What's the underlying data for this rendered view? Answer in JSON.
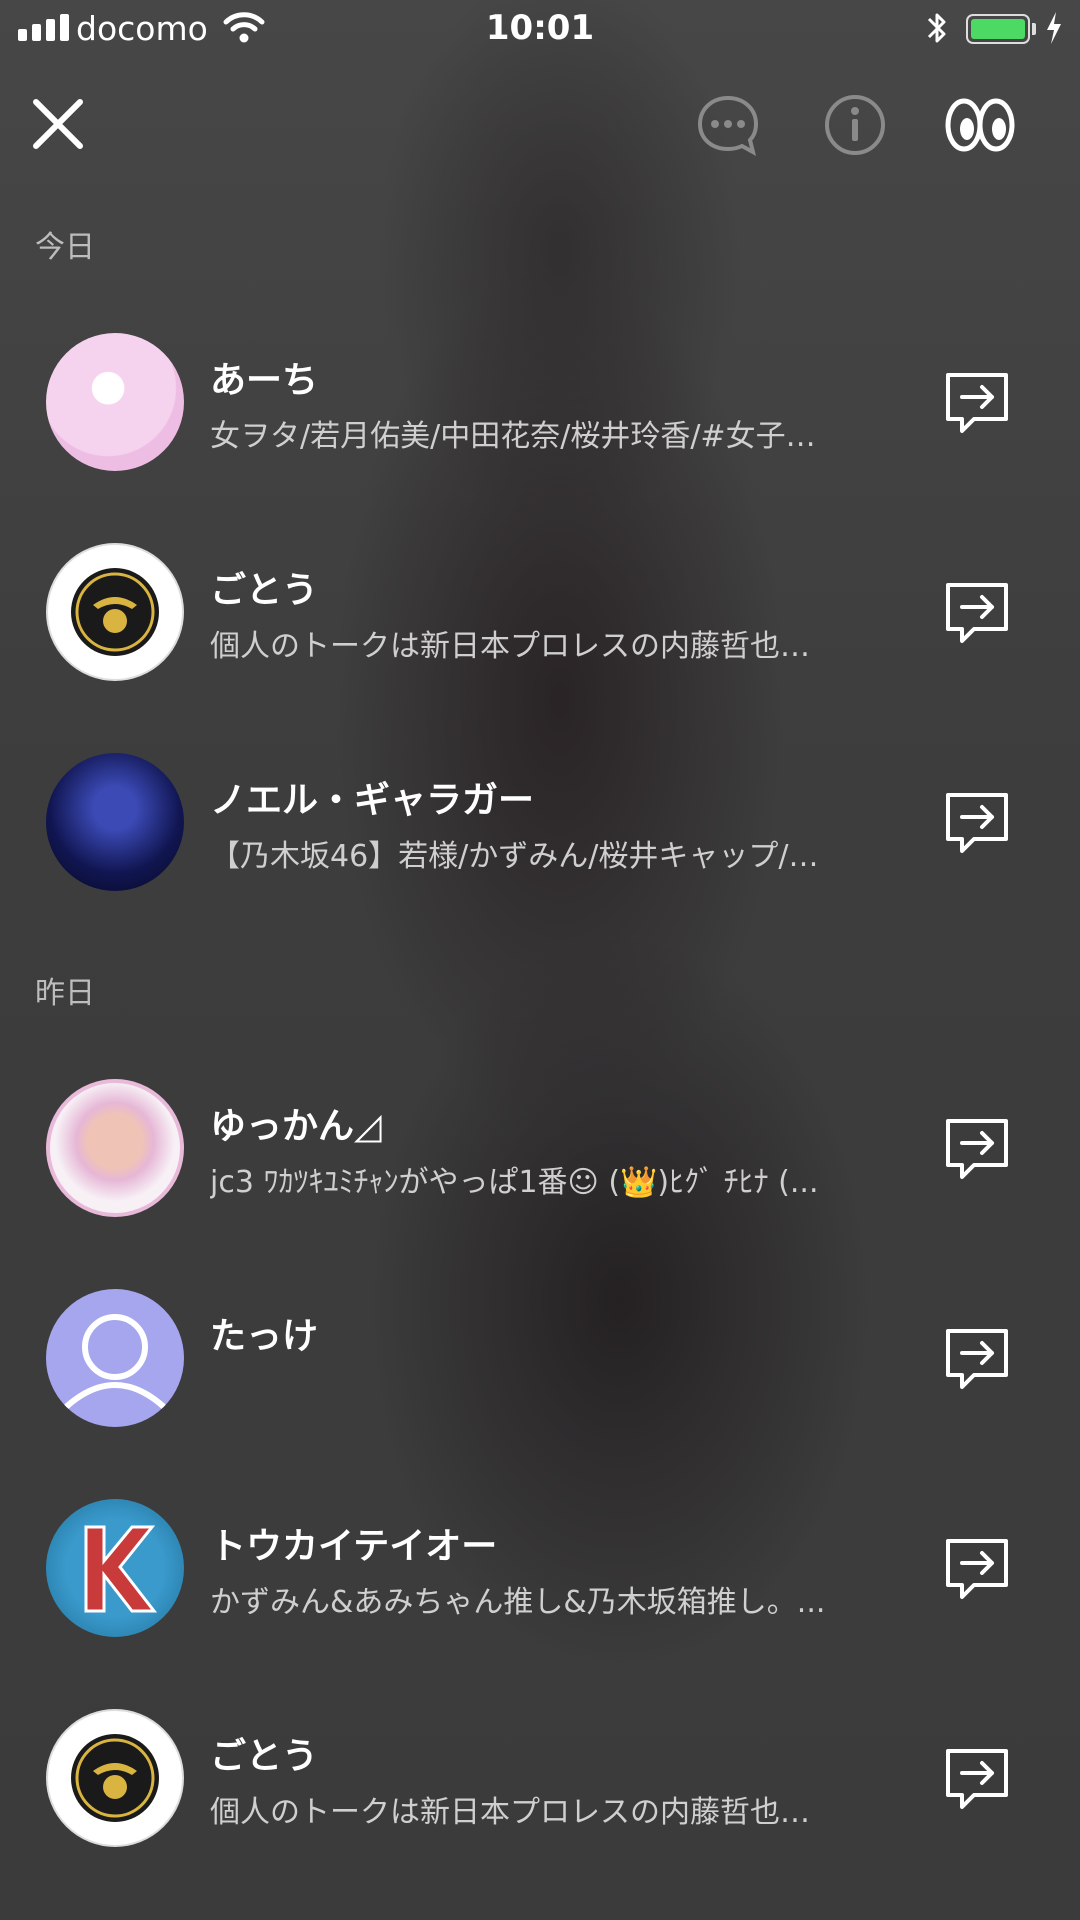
{
  "status_bar": {
    "carrier": "docomo",
    "time": "10:01"
  },
  "header": {
    "icons": [
      "close-icon",
      "chat-bubble-icon",
      "info-icon",
      "eyes-icon"
    ]
  },
  "sections": {
    "today": {
      "label": "今日",
      "items": [
        {
          "name": "あーち",
          "desc": "女ヲタ/若月佑美/中田花奈/桜井玲香/#女子…"
        },
        {
          "name": "ごとう",
          "desc": "個人のトークは新日本プロレスの内藤哲也…"
        },
        {
          "name": "ノエル・ギャラガー",
          "desc": "【乃木坂46】若様/かずみん/桜井キャップ/…"
        }
      ]
    },
    "yesterday": {
      "label": "昨日",
      "items": [
        {
          "name": "ゆっかん◿",
          "desc": "jc3 ﾜｶﾂｷﾕﾐﾁｬﾝがやっぱ1番☺ (👑)ﾋｸﾞ ﾁﾋﾅ (..."
        },
        {
          "name": "たっけ",
          "desc": ""
        },
        {
          "name": "トウカイテイオー",
          "desc": "かずみん&あみちゃん推し&乃木坂箱推し。..."
        },
        {
          "name": "ごとう",
          "desc": "個人のトークは新日本プロレスの内藤哲也…"
        }
      ]
    }
  },
  "colors": {
    "battery": "#4cd964",
    "default_avatar": "#a6a6ef"
  }
}
